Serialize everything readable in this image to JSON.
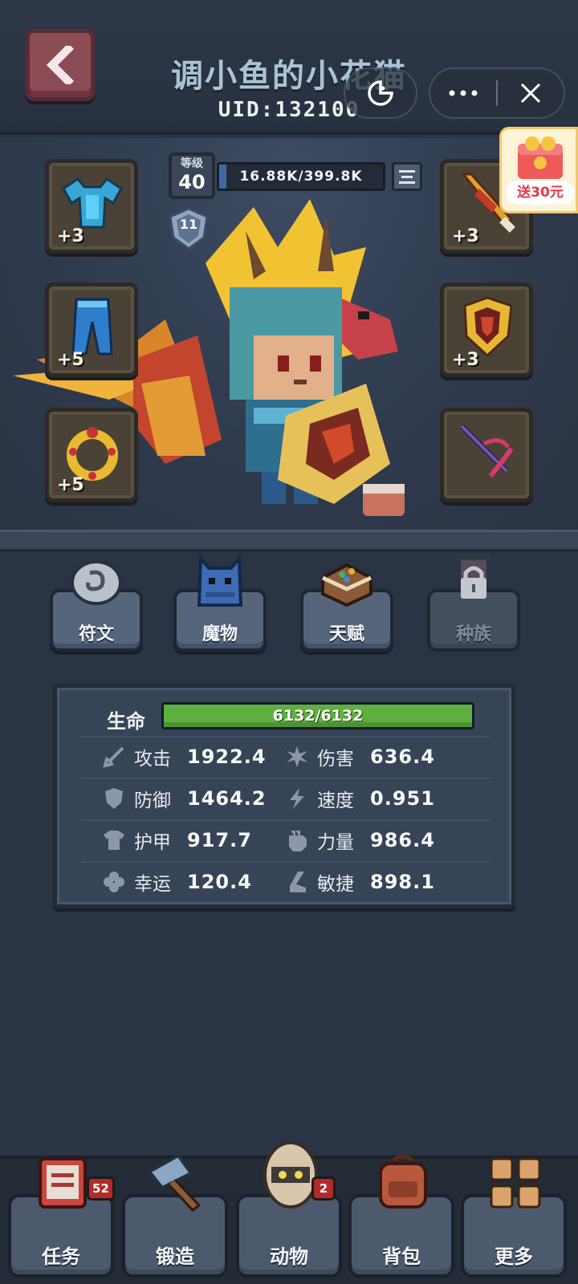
{
  "header": {
    "title": "调小鱼的小花猫",
    "uid": "UID:132100"
  },
  "player": {
    "level_label": "等级",
    "level": "40",
    "exp_text": "16.88K/399.8K",
    "exp_fraction": 0.042,
    "rank": "11"
  },
  "promo": {
    "text": "送30元"
  },
  "equipment": [
    {
      "slot": "chest",
      "icon": "armor-icon",
      "level": "+3"
    },
    {
      "slot": "pants",
      "icon": "pants-icon",
      "level": "+5"
    },
    {
      "slot": "ring",
      "icon": "ring-icon",
      "level": "+5"
    },
    {
      "slot": "weapon",
      "icon": "sword-icon",
      "level": "+3"
    },
    {
      "slot": "shield",
      "icon": "shield-icon",
      "level": "+3"
    },
    {
      "slot": "crossbow",
      "icon": "crossbow-icon",
      "level": ""
    }
  ],
  "features": [
    {
      "label": "符文",
      "icon": "rune-icon",
      "locked": false
    },
    {
      "label": "魔物",
      "icon": "monster-icon",
      "locked": false
    },
    {
      "label": "天赋",
      "icon": "talent-book-icon",
      "locked": false
    },
    {
      "label": "种族",
      "icon": "lock-icon",
      "locked": true
    }
  ],
  "stats": {
    "life_label": "生命",
    "hp_text": "6132/6132",
    "hp_fraction": 1.0,
    "items": [
      {
        "label": "攻击",
        "value": "1922.4",
        "icon": "sword-icon"
      },
      {
        "label": "伤害",
        "value": "636.4",
        "icon": "burst-icon"
      },
      {
        "label": "防御",
        "value": "1464.2",
        "icon": "shield-icon"
      },
      {
        "label": "速度",
        "value": "0.951",
        "icon": "lightning-icon"
      },
      {
        "label": "护甲",
        "value": "917.7",
        "icon": "armor-icon"
      },
      {
        "label": "力量",
        "value": "986.4",
        "icon": "fist-icon"
      },
      {
        "label": "幸运",
        "value": "120.4",
        "icon": "clover-icon"
      },
      {
        "label": "敏捷",
        "value": "898.1",
        "icon": "boot-icon"
      }
    ]
  },
  "nav": [
    {
      "label": "任务",
      "icon": "quest-board-icon",
      "badge": "52"
    },
    {
      "label": "锻造",
      "icon": "hammer-icon",
      "badge": ""
    },
    {
      "label": "动物",
      "icon": "egg-pet-icon",
      "badge": "2"
    },
    {
      "label": "背包",
      "icon": "backpack-icon",
      "badge": ""
    },
    {
      "label": "更多",
      "icon": "grid-more-icon",
      "badge": ""
    }
  ],
  "colors": {
    "background": "#2b3444",
    "accent_hp": "#5eb03e",
    "accent_exp": "#3d69a8",
    "badge_red": "#b32a2a"
  }
}
